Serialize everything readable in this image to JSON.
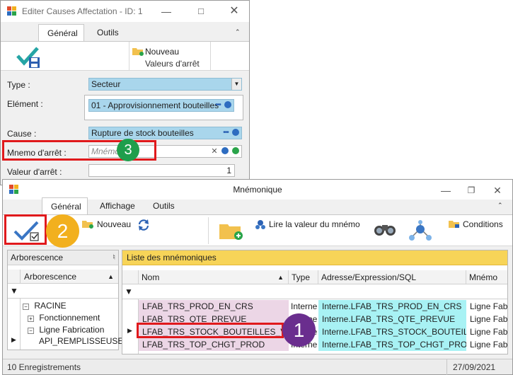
{
  "cause_window": {
    "title": "Editer Causes Affectation - ID: 1",
    "tabs": [
      "Général",
      "Outils"
    ],
    "ribbon": {
      "nouveau_label": "Nouveau",
      "group_label": "Valeurs d'arrêt"
    },
    "form": {
      "type_label": "Type :",
      "type_value": "Secteur",
      "element_label": "Elément :",
      "element_value": "01 - Approvisionnement bouteilles",
      "cause_label": "Cause :",
      "cause_value": "Rupture de stock bouteilles",
      "mnemo_label": "Mnemo d'arrêt :",
      "mnemo_placeholder": "Mnémo",
      "valeur_label": "Valeur d'arrêt :",
      "valeur_value": "1"
    }
  },
  "mnemo_window": {
    "title": "Mnémonique",
    "tabs": [
      "Général",
      "Affichage",
      "Outils"
    ],
    "ribbon": {
      "nouveau_label": "Nouveau",
      "lire_label": "Lire la valeur du mnémo",
      "conditions_label": "Conditions"
    },
    "tree": {
      "panel_title": "Arborescence",
      "column_header": "Arborescence",
      "nodes": [
        "RACINE",
        "Fonctionnement",
        "Ligne Fabrication",
        "API_REMPLISSEUSE"
      ]
    },
    "list": {
      "panel_title": "Liste des mnémoniques",
      "columns": [
        "Nom",
        "Type",
        "Adresse/Expression/SQL",
        "Mnémo"
      ],
      "rows": [
        {
          "nom": "LFAB_TRS_PROD_EN_CRS",
          "type": "Interne",
          "adresse": "Interne.LFAB_TRS_PROD_EN_CRS",
          "mnemo": "Ligne Fab"
        },
        {
          "nom": "LFAB_TRS_QTE_PREVUE",
          "type": "Interne",
          "adresse": "Interne.LFAB_TRS_QTE_PREVUE",
          "mnemo": "Ligne Fab"
        },
        {
          "nom": "LFAB_TRS_STOCK_BOUTEILLES_VIDE",
          "type": "Interne",
          "adresse": "Interne.LFAB_TRS_STOCK_BOUTEILLES",
          "mnemo": "Ligne Fab"
        },
        {
          "nom": "LFAB_TRS_TOP_CHGT_PROD",
          "type": "Interne",
          "adresse": "Interne.LFAB_TRS_TOP_CHGT_PROD",
          "mnemo": "Ligne Fab"
        }
      ]
    },
    "status": {
      "count": "10 Enregistrements",
      "date": "27/09/2021"
    }
  },
  "annotations": {
    "badge_1": "1",
    "badge_2": "2",
    "badge_3": "3"
  },
  "colors": {
    "field_blue": "#a9d6ec",
    "header_yellow": "#f7d458",
    "row_pink": "#ecd6e6",
    "row_cyan": "#a8f2f4",
    "highlight_red": "#e0191c",
    "badge_purple": "#6a2e8e",
    "badge_orange": "#f2b01e",
    "badge_green": "#1f9e4c"
  }
}
